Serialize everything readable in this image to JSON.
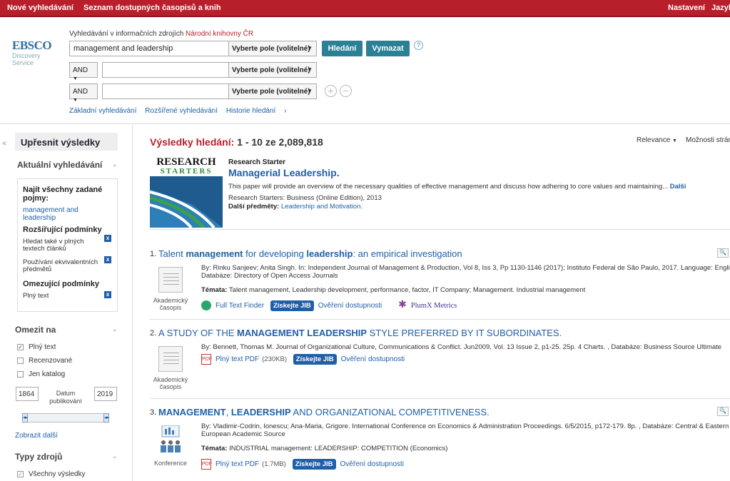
{
  "topbar": {
    "new_search": "Nové vyhledávání",
    "journals": "Seznam dostupných časopisů a knih",
    "settings": "Nastavení",
    "language": "Jazyk"
  },
  "search": {
    "logo_main": "EBSCO",
    "logo_sub": "Discovery Service",
    "source_prefix": "Vyhledávání v informačních zdrojích",
    "source_name": "Národní knihovny ČR",
    "query1": "management and leadership",
    "field_label": "Vyberte pole (volitelné)",
    "bool_label": "AND",
    "search_btn": "Hledání",
    "clear_btn": "Vymazat",
    "help": "?",
    "link_basic": "Základní vyhledávání",
    "link_advanced": "Rozšířené vyhledávání",
    "link_history": "Historie hledání"
  },
  "sidebar": {
    "title": "Upřesnit výsledky",
    "current": "Aktuální vyhledávání",
    "find_all": "Najít všechny zadané pojmy:",
    "term": "management and leadership",
    "expanders": "Rozšiřující podmínky",
    "exp1": "Hledat také v plných textech článků",
    "exp2": "Používání ekvivalentních předmětů",
    "limiters": "Omezující podmínky",
    "lim1": "Plný text",
    "limit_to": "Omezit na",
    "cb_fulltext": "Plný text",
    "cb_peer": "Recenzované",
    "cb_catalog": "Jen katalog",
    "year_from": "1864",
    "year_to": "2019",
    "date_label": "Datum publikování",
    "show_more": "Zobrazit další",
    "source_types": "Typy zdrojů",
    "all_results": "Všechny výsledky"
  },
  "results": {
    "header_label": "Výsledky hledání:",
    "header_range": "1 - 10 ze 2,089,818",
    "sort": "Relevance",
    "page_options": "Možnosti strán",
    "starter": {
      "img_line1": "RESEARCH",
      "img_line2": "STARTERS",
      "label": "Research Starter",
      "title": "Managerial Leadership.",
      "desc": "This paper will provide an overview of the necessary qualities of effective management and discuss how adhering to core values and maintaining...",
      "more": "Další",
      "meta": "Research Starters: Business (Online Edition), 2013",
      "subj_label": "Další předměty:",
      "subj": "Leadership and Motivation."
    },
    "items": [
      {
        "num": "1.",
        "title_a": "Talent ",
        "title_b": "management",
        "title_c": " for developing ",
        "title_d": "leadership",
        "title_e": ": an empirical investigation",
        "type": "Akademický časopis",
        "by1": "By: Rinku Sanjeev; Anita Singh. In: Independent Journal of Management & Production, Vol 8, Iss 3, Pp 1130-1146 (2017); Instituto Federal de São Paulo, 2017. Language: Englis",
        "by2": "Databáze: Directory of Open Access Journals",
        "subj_label": "Témata:",
        "subj": "Talent management, Leadership development, performance, factor, IT Company; Management. Industrial management",
        "a1": "Full Text Finder",
        "jib": "Získejte JIB",
        "avail": "Ověření dostupnosti",
        "plum": "PlumX Metrics"
      },
      {
        "num": "2.",
        "title_a": "A STUDY OF THE ",
        "title_b": "MANAGEMENT LEADERSHIP",
        "title_c": " STYLE PREFERRED BY IT SUBORDINATES.",
        "type": "Akademický časopis",
        "by1": "By: Bennett, Thomas M. Journal of Organizational Culture, Communications & Conflict. Jun2009, Vol. 13 Issue 2, p1-25. 25p. 4 Charts. , Databáze: Business Source Ultimate",
        "a1": "Plný text PDF",
        "size": "(230KB)",
        "jib": "Získejte JIB",
        "avail": "Ověření dostupnosti"
      },
      {
        "num": "3.",
        "title_a": "MANAGEMENT",
        "title_b": ", ",
        "title_c": "LEADERSHIP",
        "title_d": " AND ORGANIZATIONAL COMPETITIVENESS.",
        "type": "Konference",
        "by1": "By: Vladimir-Codrin, Ionescu; Ana-Maria, Grigore. International Conference on Economics & Administration Proceedings. 6/5/2015, p172-179. 8p. , Databáze: Central & Eastern",
        "by2": "European Academic Source",
        "subj_label": "Témata:",
        "subj": "INDUSTRIAL management: LEADERSHIP: COMPETITION (Economics)",
        "a1": "Plný text PDF",
        "size": "(1.7MB)",
        "jib": "Získejte JIB",
        "avail": "Ověření dostupnosti"
      }
    ]
  }
}
